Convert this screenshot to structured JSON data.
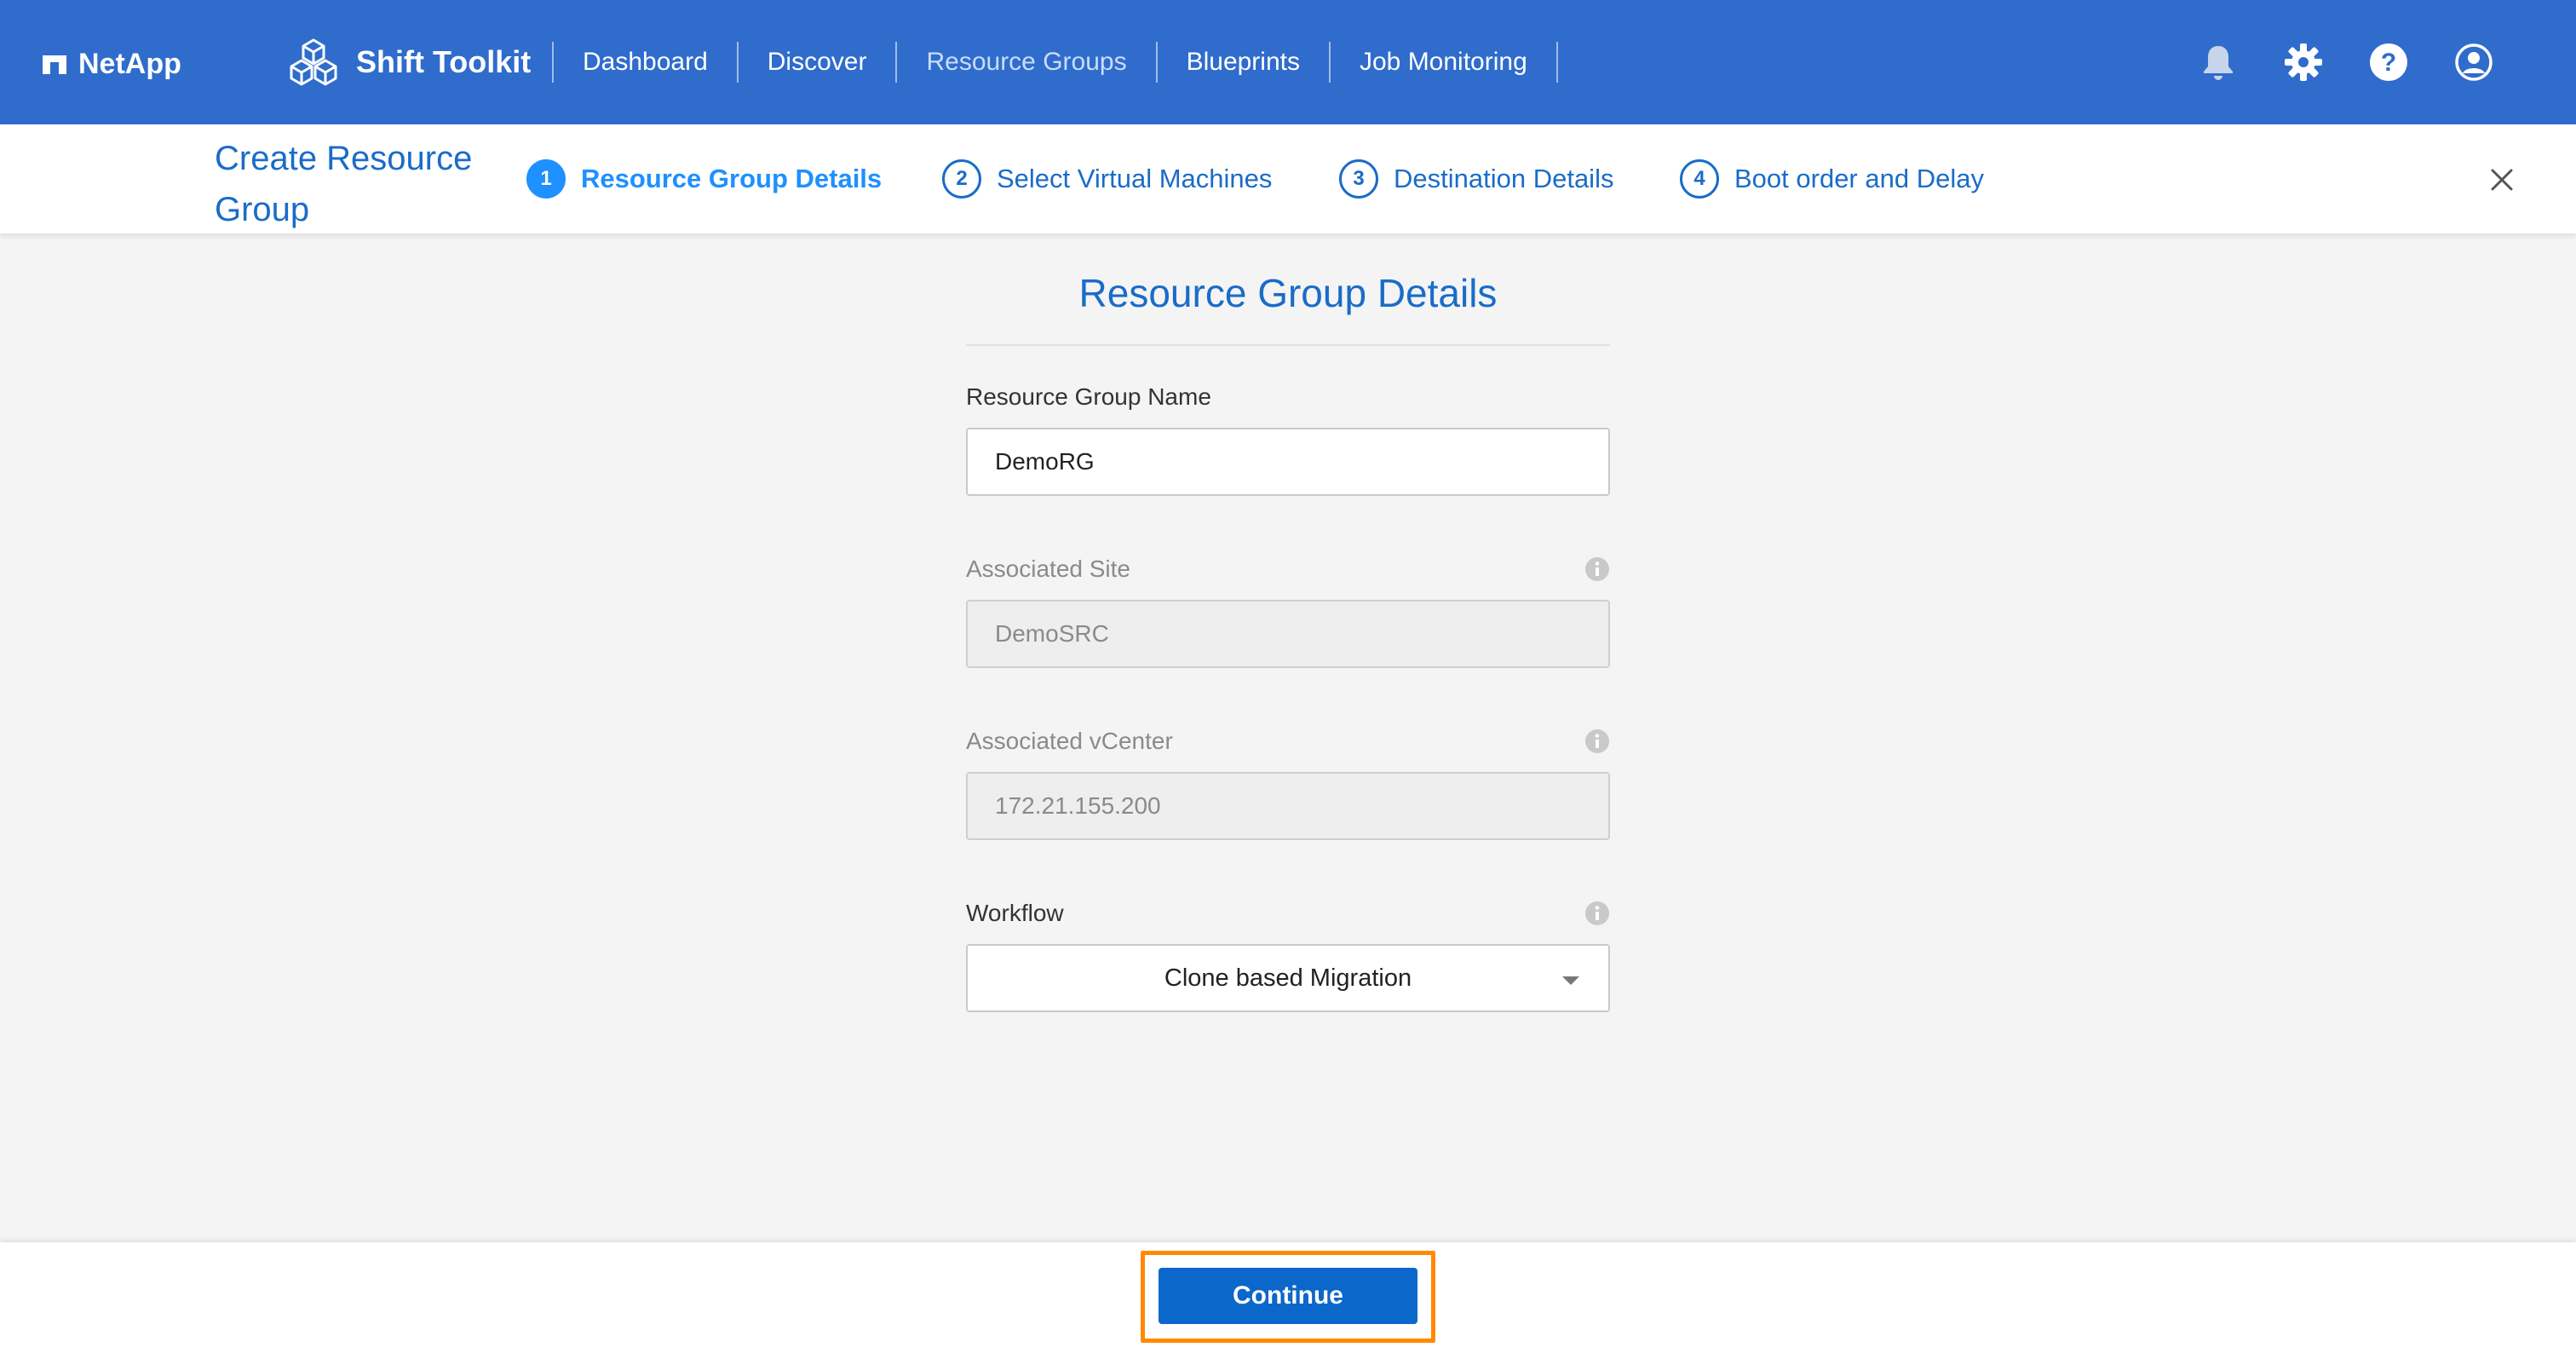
{
  "brand": {
    "name": "NetApp"
  },
  "product": {
    "name": "Shift Toolkit"
  },
  "nav": {
    "items": [
      {
        "label": "Dashboard",
        "active": false
      },
      {
        "label": "Discover",
        "active": false
      },
      {
        "label": "Resource Groups",
        "active": true
      },
      {
        "label": "Blueprints",
        "active": false
      },
      {
        "label": "Job Monitoring",
        "active": false
      }
    ],
    "icons": [
      "bell-icon",
      "gear-icon",
      "help-icon",
      "user-icon"
    ]
  },
  "wizard": {
    "title": "Create Resource Group",
    "steps": [
      {
        "number": "1",
        "label": "Resource Group Details",
        "active": true
      },
      {
        "number": "2",
        "label": "Select Virtual Machines",
        "active": false
      },
      {
        "number": "3",
        "label": "Destination Details",
        "active": false
      },
      {
        "number": "4",
        "label": "Boot order and Delay",
        "active": false
      }
    ]
  },
  "form": {
    "title": "Resource Group Details",
    "resource_group_name": {
      "label": "Resource Group Name",
      "value": "DemoRG"
    },
    "associated_site": {
      "label": "Associated Site",
      "value": "DemoSRC",
      "disabled": true
    },
    "associated_vcenter": {
      "label": "Associated vCenter",
      "value": "172.21.155.200",
      "disabled": true
    },
    "workflow": {
      "label": "Workflow",
      "value": "Clone based Migration"
    }
  },
  "footer": {
    "continue_label": "Continue"
  },
  "colors": {
    "nav_bg": "#2f6ccc",
    "accent": "#1a6cc8",
    "active_step": "#1e90ff",
    "button": "#0b67c9",
    "highlight": "#ff8a00"
  }
}
